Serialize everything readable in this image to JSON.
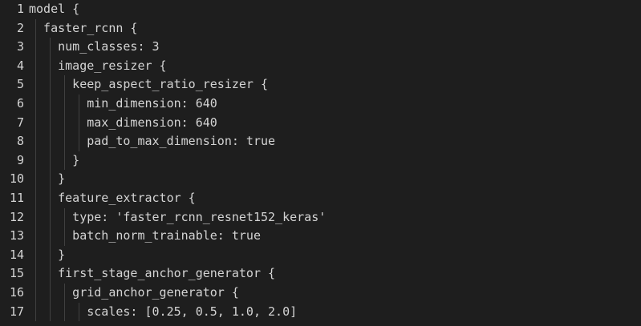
{
  "editor": {
    "lines": [
      {
        "number": "1",
        "text": "model {"
      },
      {
        "number": "2",
        "text": "  faster_rcnn {"
      },
      {
        "number": "3",
        "text": "    num_classes: 3"
      },
      {
        "number": "4",
        "text": "    image_resizer {"
      },
      {
        "number": "5",
        "text": "      keep_aspect_ratio_resizer {"
      },
      {
        "number": "6",
        "text": "        min_dimension: 640"
      },
      {
        "number": "7",
        "text": "        max_dimension: 640"
      },
      {
        "number": "8",
        "text": "        pad_to_max_dimension: true"
      },
      {
        "number": "9",
        "text": "      }"
      },
      {
        "number": "10",
        "text": "    }"
      },
      {
        "number": "11",
        "text": "    feature_extractor {"
      },
      {
        "number": "12",
        "text": "      type: 'faster_rcnn_resnet152_keras'"
      },
      {
        "number": "13",
        "text": "      batch_norm_trainable: true"
      },
      {
        "number": "14",
        "text": "    }"
      },
      {
        "number": "15",
        "text": "    first_stage_anchor_generator {"
      },
      {
        "number": "16",
        "text": "      grid_anchor_generator {"
      },
      {
        "number": "17",
        "text": "        scales: [0.25, 0.5, 1.0, 2.0]"
      }
    ]
  }
}
